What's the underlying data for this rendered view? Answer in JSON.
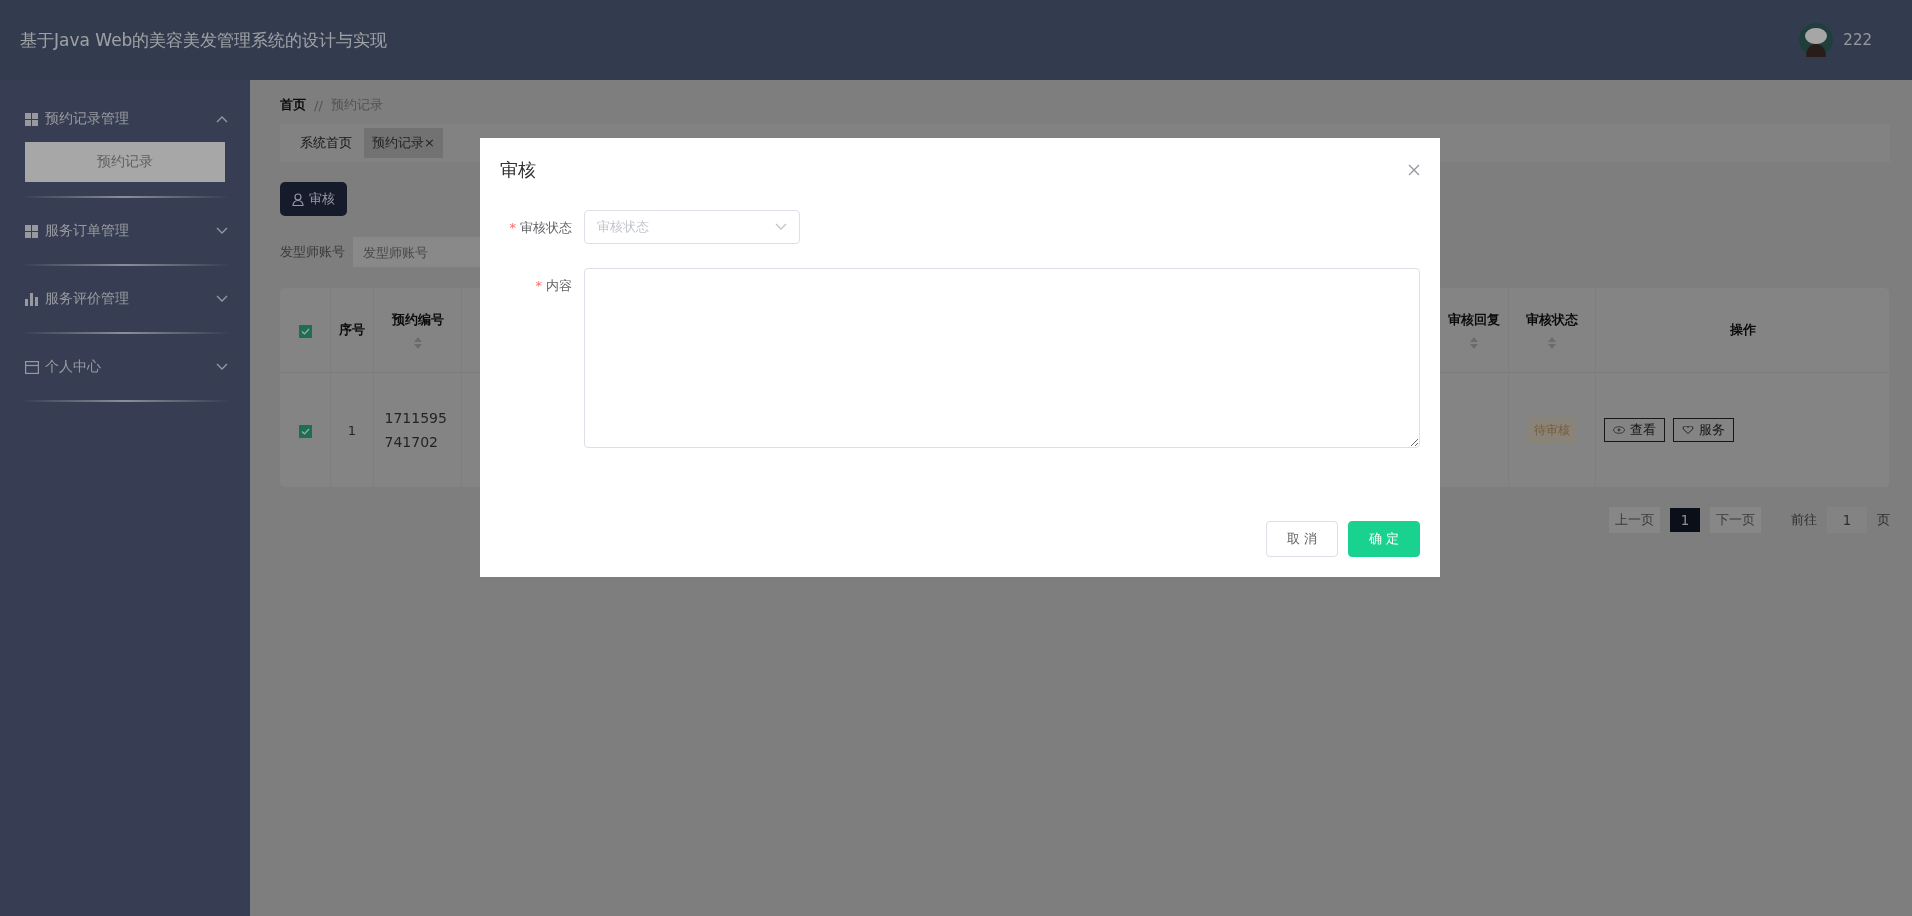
{
  "header": {
    "title": "基于Java Web的美容美发管理系统的设计与实现",
    "username": "222"
  },
  "sidebar": {
    "menus": [
      {
        "label": "预约记录管理",
        "expanded": true,
        "children": [
          {
            "label": "预约记录",
            "selected": true
          }
        ]
      },
      {
        "label": "服务订单管理",
        "expanded": false
      },
      {
        "label": "服务评价管理",
        "expanded": false
      },
      {
        "label": "个人中心",
        "expanded": false
      }
    ]
  },
  "breadcrumb": {
    "home": "首页",
    "separator": "//",
    "current": "预约记录"
  },
  "tabs": [
    {
      "label": "系统首页",
      "selected": false
    },
    {
      "label": "预约记录",
      "selected": true,
      "close_mark": "×"
    }
  ],
  "toolbar": {
    "audit_button": "审核"
  },
  "search": {
    "label": "发型师账号",
    "placeholder": "发型师账号"
  },
  "table": {
    "all_checked": true,
    "columns": [
      {
        "label": "序号",
        "sortable": false
      },
      {
        "label": "预约编号",
        "sortable": true
      },
      {
        "label": "审核回复",
        "sortable": true
      },
      {
        "label": "审核状态",
        "sortable": true
      },
      {
        "label": "操作",
        "sortable": false
      }
    ],
    "rows": [
      {
        "checked": true,
        "index": "1",
        "booking_no": "1711595741702",
        "status": "待审核",
        "actions": [
          {
            "label": "查看"
          },
          {
            "label": "服务"
          }
        ]
      }
    ]
  },
  "pagination": {
    "prev": "上一页",
    "pages": [
      {
        "label": "1",
        "selected": true
      }
    ],
    "next": "下一页",
    "goto": "前往",
    "page_input": "1",
    "suffix": "页"
  },
  "dialog": {
    "title": "审核",
    "required_mark": "*",
    "fields": [
      {
        "kind": "select",
        "label": "审核状态",
        "required": true,
        "placeholder": "审核状态"
      },
      {
        "kind": "textarea",
        "label": "内容",
        "required": true
      }
    ],
    "cancel": "取 消",
    "confirm": "确 定"
  }
}
